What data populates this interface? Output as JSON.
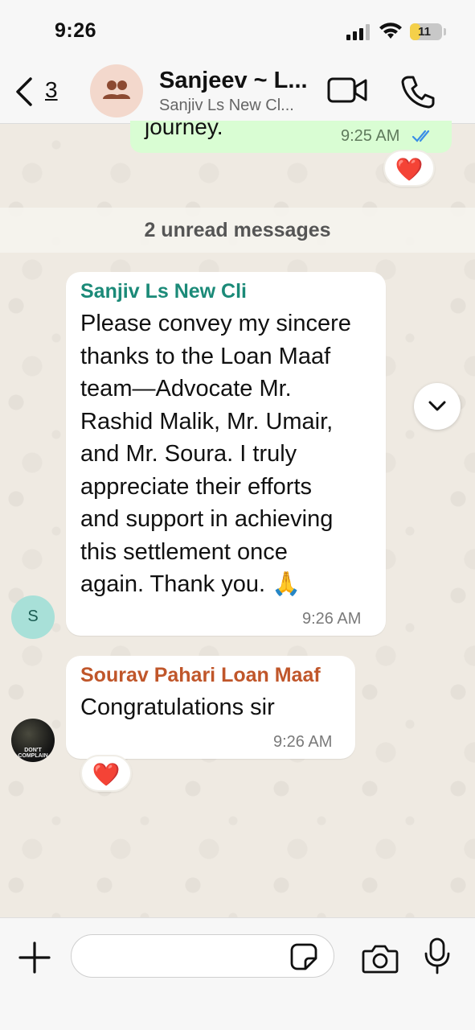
{
  "status_bar": {
    "time": "9:26",
    "battery": "11",
    "battery_level": 0.11
  },
  "header": {
    "back_count": "3",
    "title": "Sanjeev ~ L...",
    "subtitle": "Sanjiv Ls New Cl..."
  },
  "messages": {
    "outgoing_partial": {
      "text": "journey.",
      "time": "9:25 AM",
      "reaction": "❤️"
    },
    "unread_banner": "2 unread messages",
    "incoming": [
      {
        "sender": "Sanjiv Ls New Cli",
        "sender_color": "#1b8a78",
        "avatar_initial": "S",
        "lines": [
          "Please convey my sincere",
          "thanks to the Loan Maaf",
          "team—Advocate Mr.",
          "Rashid Malik, Mr. Umair,",
          "and Mr. Soura. I truly",
          "appreciate their efforts",
          "and support in achieving",
          "this settlement once",
          "again. Thank you. 🙏"
        ],
        "time": "9:26 AM"
      },
      {
        "sender": "Sourav Pahari Loan Maaf",
        "sender_color": "#c0562a",
        "avatar_caption": "DON'T COMPLAIN",
        "text": "Congratulations sir",
        "time": "9:26 AM",
        "reaction": "❤️"
      }
    ]
  },
  "input_bar": {
    "placeholder": ""
  },
  "icons": [
    "back-chevron-icon",
    "group-avatar-icon",
    "video-call-icon",
    "phone-icon",
    "double-check-icon",
    "chevron-down-icon",
    "plus-icon",
    "sticker-icon",
    "camera-icon",
    "microphone-icon"
  ]
}
